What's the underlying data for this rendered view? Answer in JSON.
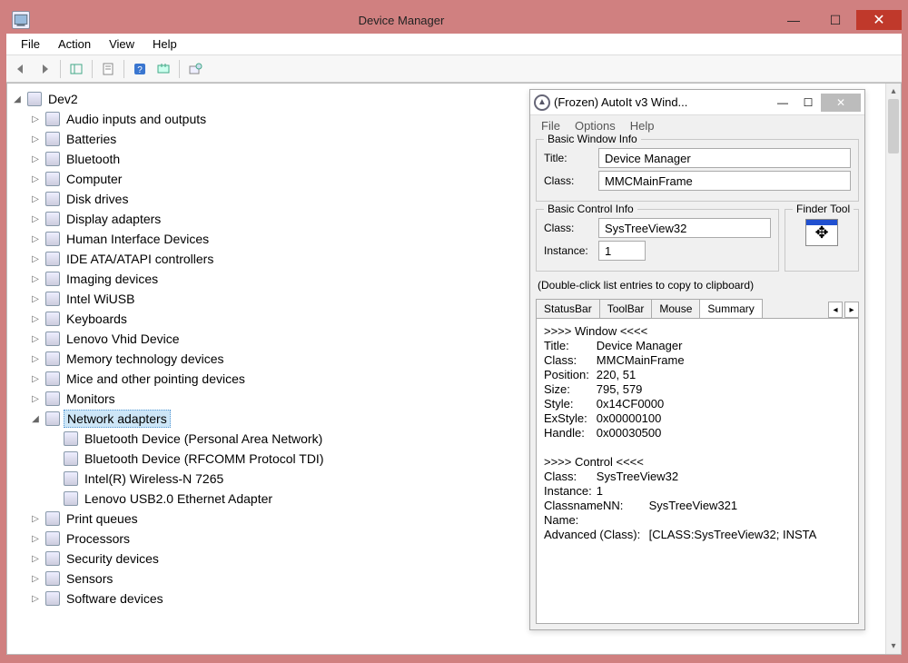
{
  "window": {
    "title": "Device Manager"
  },
  "menubar": [
    "File",
    "Action",
    "View",
    "Help"
  ],
  "tree_root": "Dev2",
  "tree": [
    {
      "label": "Audio inputs and outputs",
      "icon": "audio-icon"
    },
    {
      "label": "Batteries",
      "icon": "battery-icon"
    },
    {
      "label": "Bluetooth",
      "icon": "bluetooth-icon"
    },
    {
      "label": "Computer",
      "icon": "computer-icon"
    },
    {
      "label": "Disk drives",
      "icon": "disk-icon"
    },
    {
      "label": "Display adapters",
      "icon": "display-icon"
    },
    {
      "label": "Human Interface Devices",
      "icon": "hid-icon"
    },
    {
      "label": "IDE ATA/ATAPI controllers",
      "icon": "ide-icon"
    },
    {
      "label": "Imaging devices",
      "icon": "imaging-icon"
    },
    {
      "label": "Intel WiUSB",
      "icon": "wiusb-icon"
    },
    {
      "label": "Keyboards",
      "icon": "keyboard-icon"
    },
    {
      "label": "Lenovo Vhid Device",
      "icon": "vhid-icon"
    },
    {
      "label": "Memory technology devices",
      "icon": "memory-icon"
    },
    {
      "label": "Mice and other pointing devices",
      "icon": "mouse-icon"
    },
    {
      "label": "Monitors",
      "icon": "monitor-icon"
    },
    {
      "label": "Network adapters",
      "icon": "network-icon",
      "expanded": true,
      "selected": true,
      "children": [
        {
          "label": "Bluetooth Device (Personal Area Network)",
          "icon": "net-child-icon"
        },
        {
          "label": "Bluetooth Device (RFCOMM Protocol TDI)",
          "icon": "net-child-icon"
        },
        {
          "label": "Intel(R) Wireless-N 7265",
          "icon": "net-child-icon"
        },
        {
          "label": "Lenovo USB2.0 Ethernet Adapter",
          "icon": "net-child-icon"
        }
      ]
    },
    {
      "label": "Print queues",
      "icon": "printer-icon"
    },
    {
      "label": "Processors",
      "icon": "processor-icon"
    },
    {
      "label": "Security devices",
      "icon": "security-icon"
    },
    {
      "label": "Sensors",
      "icon": "sensors-icon"
    },
    {
      "label": "Software devices",
      "icon": "software-icon"
    }
  ],
  "autoit": {
    "title": "(Frozen) AutoIt v3 Wind...",
    "menubar": [
      "File",
      "Options",
      "Help"
    ],
    "basic_window": {
      "legend": "Basic Window Info",
      "title_label": "Title:",
      "title_value": "Device Manager",
      "class_label": "Class:",
      "class_value": "MMCMainFrame"
    },
    "basic_control": {
      "legend": "Basic Control Info",
      "class_label": "Class:",
      "class_value": "SysTreeView32",
      "instance_label": "Instance:",
      "instance_value": "1"
    },
    "finder_legend": "Finder Tool",
    "hint": "(Double-click list entries to copy to clipboard)",
    "tabs": [
      "StatusBar",
      "ToolBar",
      "Mouse",
      "Summary"
    ],
    "active_tab": "Summary",
    "summary_text": ">>>> Window <<<<\nTitle:\tDevice Manager\nClass:\tMMCMainFrame\nPosition:\t220, 51\nSize:\t795, 579\nStyle:\t0x14CF0000\nExStyle:\t0x00000100\nHandle:\t0x00030500\n\n>>>> Control <<<<\nClass:\tSysTreeView32\nInstance:\t1\nClassnameNN:\tSysTreeView321\nName:\nAdvanced (Class):\t[CLASS:SysTreeView32; INSTA"
  }
}
